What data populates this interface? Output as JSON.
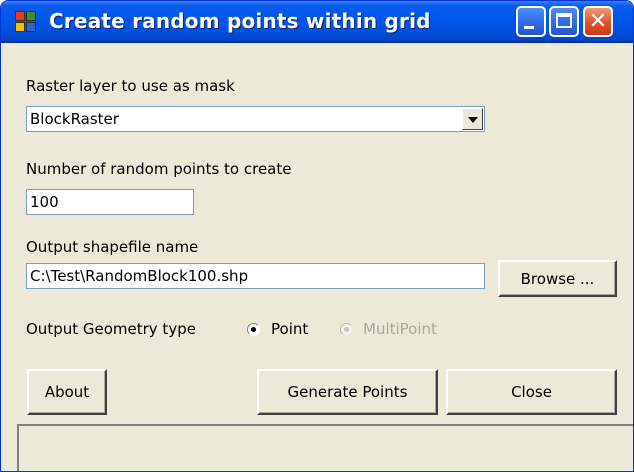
{
  "window": {
    "title": "Create random points within grid",
    "icon": "app-icon",
    "controls": {
      "minimize": "minimize-icon",
      "maximize": "maximize-icon",
      "close": "✕"
    }
  },
  "raster": {
    "label": "Raster layer to use as mask",
    "selected": "BlockRaster"
  },
  "points": {
    "label": "Number of random points to create",
    "value": "100"
  },
  "output": {
    "label": "Output shapefile name",
    "value": "C:\\Test\\RandomBlock100.shp",
    "browse_label": "Browse ..."
  },
  "geometry": {
    "label": "Output Geometry type",
    "options": [
      {
        "label": "Point",
        "selected": true,
        "enabled": true
      },
      {
        "label": "MultiPoint",
        "selected": false,
        "enabled": false
      }
    ]
  },
  "buttons": {
    "about": "About",
    "generate": "Generate Points",
    "close": "Close"
  },
  "colors": {
    "titlebar": "#0058ee",
    "window_bg": "#ece9d8",
    "disabled_text": "#aca899"
  }
}
